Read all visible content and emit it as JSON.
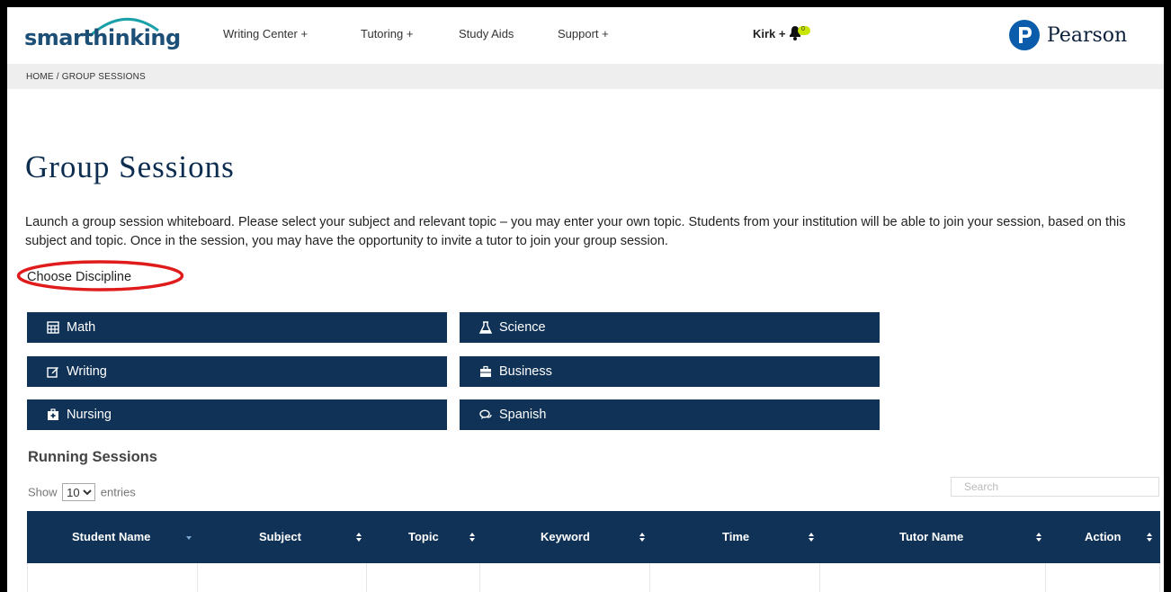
{
  "brand": {
    "logo_text": "smarthinking",
    "partner": "Pearson"
  },
  "nav": {
    "items": [
      "Writing Center +",
      "Tutoring +",
      "Study Aids",
      "Support +"
    ],
    "user": "Kirk +",
    "notification_count": "0"
  },
  "breadcrumb": "HOME / GROUP SESSIONS",
  "page": {
    "title": "Group Sessions",
    "intro": "Launch a group session whiteboard. Please select your subject and relevant topic – you may enter your own topic. Students from your institution will be able to join your session, based on this subject and topic. Once in the session, you may have the opportunity to invite a tutor to join your group session.",
    "choose_label": "Choose Discipline"
  },
  "disciplines": [
    {
      "label": "Math",
      "icon": "calculator-icon"
    },
    {
      "label": "Science",
      "icon": "flask-icon"
    },
    {
      "label": "Writing",
      "icon": "edit-icon"
    },
    {
      "label": "Business",
      "icon": "briefcase-icon"
    },
    {
      "label": "Nursing",
      "icon": "medkit-icon"
    },
    {
      "label": "Spanish",
      "icon": "chat-bubbles-icon"
    }
  ],
  "running": {
    "title": "Running Sessions",
    "show_prefix": "Show",
    "entries_value": "10",
    "show_suffix": "entries",
    "search_placeholder": "Search",
    "columns": [
      "Student Name",
      "Subject",
      "Topic",
      "Keyword",
      "Time",
      "Tutor Name",
      "Action"
    ]
  },
  "colors": {
    "primary": "#0f3256",
    "title": "#0c2d4f",
    "highlight": "#e01b1b",
    "badge": "#c8e600"
  }
}
